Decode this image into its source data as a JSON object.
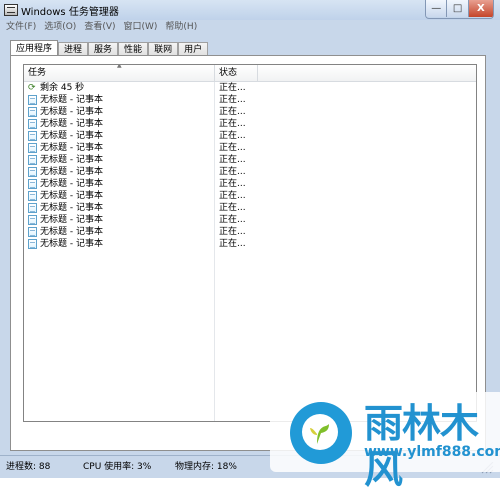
{
  "window": {
    "title": "Windows 任务管理器",
    "controls": {
      "minimize": "—",
      "maximize": "□",
      "close": "X"
    }
  },
  "menu": [
    "文件(F)",
    "选项(O)",
    "查看(V)",
    "窗口(W)",
    "帮助(H)"
  ],
  "tabs": [
    "应用程序",
    "进程",
    "服务",
    "性能",
    "联网",
    "用户"
  ],
  "list": {
    "headers": {
      "task": "任务",
      "status": "状态"
    },
    "sort_indicator": "▲",
    "rows": [
      {
        "name": "剩余 45 秒",
        "status": "正在...",
        "icon": "countdown-icon"
      },
      {
        "name": "无标题 - 记事本",
        "status": "正在...",
        "icon": "notepad-icon"
      },
      {
        "name": "无标题 - 记事本",
        "status": "正在...",
        "icon": "notepad-icon"
      },
      {
        "name": "无标题 - 记事本",
        "status": "正在...",
        "icon": "notepad-icon"
      },
      {
        "name": "无标题 - 记事本",
        "status": "正在...",
        "icon": "notepad-icon"
      },
      {
        "name": "无标题 - 记事本",
        "status": "正在...",
        "icon": "notepad-icon"
      },
      {
        "name": "无标题 - 记事本",
        "status": "正在...",
        "icon": "notepad-icon"
      },
      {
        "name": "无标题 - 记事本",
        "status": "正在...",
        "icon": "notepad-icon"
      },
      {
        "name": "无标题 - 记事本",
        "status": "正在...",
        "icon": "notepad-icon"
      },
      {
        "name": "无标题 - 记事本",
        "status": "正在...",
        "icon": "notepad-icon"
      },
      {
        "name": "无标题 - 记事本",
        "status": "正在...",
        "icon": "notepad-icon"
      },
      {
        "name": "无标题 - 记事本",
        "status": "正在...",
        "icon": "notepad-icon"
      },
      {
        "name": "无标题 - 记事本",
        "status": "正在...",
        "icon": "notepad-icon"
      },
      {
        "name": "无标题 - 记事本",
        "status": "正在...",
        "icon": "notepad-icon"
      }
    ]
  },
  "statusbar": {
    "processes": "进程数: 88",
    "cpu": "CPU 使用率: 3%",
    "memory": "物理内存: 18%"
  },
  "watermark": {
    "name": "雨林木风",
    "url": "www.ylmf888.com",
    "brand_color": "#2292d0"
  }
}
